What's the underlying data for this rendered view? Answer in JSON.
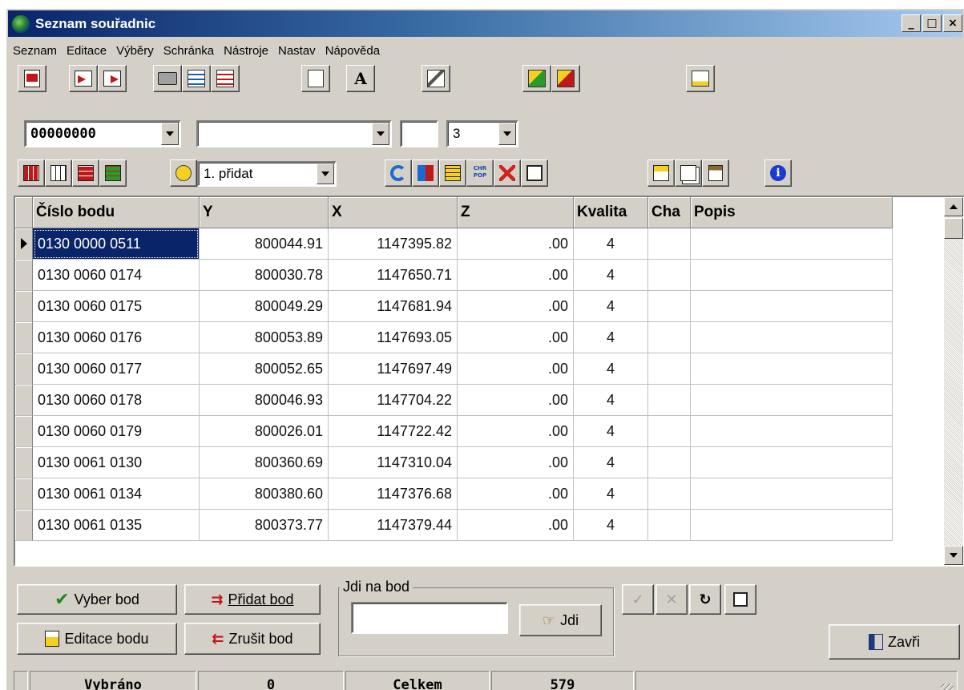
{
  "window": {
    "title": "Seznam souřadnic",
    "controls": {
      "minimize": "_",
      "maximize": "□",
      "close": "×"
    }
  },
  "menu": [
    "Seznam",
    "Editace",
    "Výběry",
    "Schránka",
    "Nástroje",
    "Nastav",
    "Nápověda"
  ],
  "filter_bar": {
    "combo1_value": "00000000",
    "combo2_value": "",
    "small_field_value": "",
    "combo3_value": "3"
  },
  "toolbar2": {
    "mode_combo_value": "1. přidat"
  },
  "grid": {
    "columns": [
      "Číslo bodu",
      "Y",
      "X",
      "Z",
      "Kvalita",
      "Cha",
      "Popis"
    ],
    "rows": [
      [
        "0130 0000 0511",
        "800044.91",
        "1147395.82",
        ".00",
        "4",
        "",
        ""
      ],
      [
        "0130 0060 0174",
        "800030.78",
        "1147650.71",
        ".00",
        "4",
        "",
        ""
      ],
      [
        "0130 0060 0175",
        "800049.29",
        "1147681.94",
        ".00",
        "4",
        "",
        ""
      ],
      [
        "0130 0060 0176",
        "800053.89",
        "1147693.05",
        ".00",
        "4",
        "",
        ""
      ],
      [
        "0130 0060 0177",
        "800052.65",
        "1147697.49",
        ".00",
        "4",
        "",
        ""
      ],
      [
        "0130 0060 0178",
        "800046.93",
        "1147704.22",
        ".00",
        "4",
        "",
        ""
      ],
      [
        "0130 0060 0179",
        "800026.01",
        "1147722.42",
        ".00",
        "4",
        "",
        ""
      ],
      [
        "0130 0061 0130",
        "800360.69",
        "1147310.04",
        ".00",
        "4",
        "",
        ""
      ],
      [
        "0130 0061 0134",
        "800380.60",
        "1147376.68",
        ".00",
        "4",
        "",
        ""
      ],
      [
        "0130 0061 0135",
        "800373.77",
        "1147379.44",
        ".00",
        "4",
        "",
        ""
      ]
    ],
    "selected_row": 0
  },
  "bottom": {
    "vyber_bod": "Vyber bod",
    "pridat_bod": "Přidat bod",
    "editace_bodu": "Editace bodu",
    "zrusit_bod": "Zrušit bod",
    "jdi_group_title": "Jdi na bod",
    "jdi_input_value": "",
    "jdi_button": "Jdi",
    "zavri": "Zavři"
  },
  "status": {
    "label1": "Vybráno",
    "value1": "0",
    "label2": "Celkem",
    "value2": "579"
  },
  "colors": {
    "selection": "#0a246a",
    "face": "#d4d0c8",
    "title_start": "#0a246a",
    "title_end": "#a6caf0"
  }
}
